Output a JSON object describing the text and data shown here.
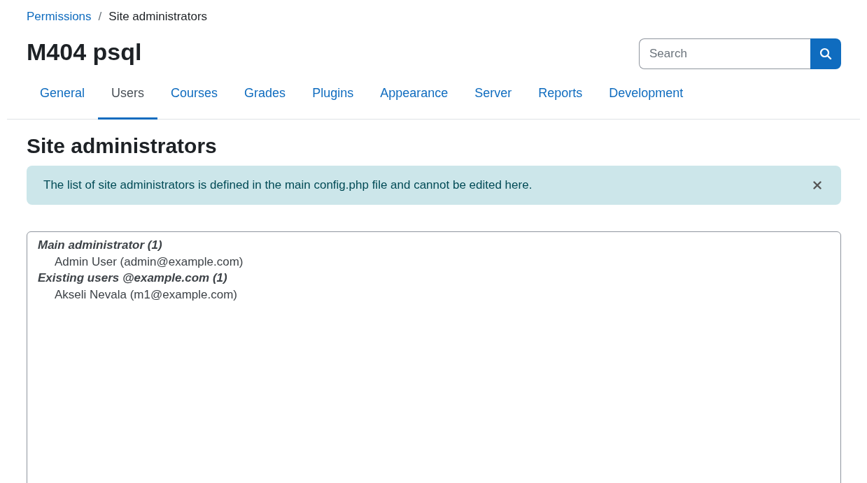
{
  "breadcrumb": [
    {
      "label": "Permissions",
      "link": true
    },
    {
      "label": "Site administrators",
      "link": false
    }
  ],
  "breadcrumb_separator": "/",
  "page_title": "M404 psql",
  "search": {
    "placeholder": "Search"
  },
  "tabs": [
    {
      "label": "General",
      "selected": false
    },
    {
      "label": "Users",
      "selected": true
    },
    {
      "label": "Courses",
      "selected": false
    },
    {
      "label": "Grades",
      "selected": false
    },
    {
      "label": "Plugins",
      "selected": false
    },
    {
      "label": "Appearance",
      "selected": false
    },
    {
      "label": "Server",
      "selected": false
    },
    {
      "label": "Reports",
      "selected": false
    },
    {
      "label": "Development",
      "selected": false
    }
  ],
  "heading": "Site administrators",
  "alert": {
    "text": "The list of site administrators is defined in the main config.php file and cannot be edited here."
  },
  "admin_list": [
    {
      "group": "Main administrator (1)",
      "options": [
        "Admin User (admin@example.com)"
      ]
    },
    {
      "group": "Existing users @example.com (1)",
      "options": [
        "Akseli Nevala (m1@example.com)"
      ]
    }
  ]
}
